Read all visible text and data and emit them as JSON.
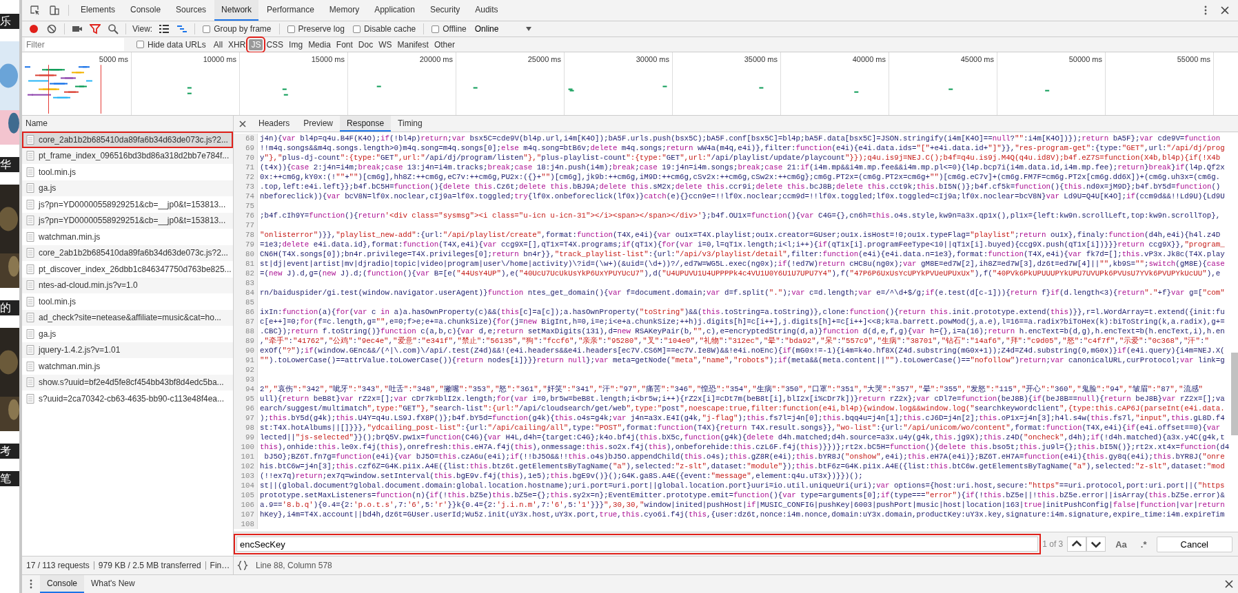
{
  "background_page": {
    "items": [
      {
        "kind": "text",
        "text": "乐"
      },
      {
        "kind": "picture"
      },
      {
        "kind": "text",
        "text": "华"
      },
      {
        "kind": "picture"
      },
      {
        "kind": "text",
        "text": "的"
      },
      {
        "kind": "picture"
      },
      {
        "kind": "text",
        "text": "考"
      },
      {
        "kind": "text",
        "text": "笔"
      }
    ]
  },
  "devtools": {
    "tabs": [
      {
        "label": "Elements",
        "selected": false
      },
      {
        "label": "Console",
        "selected": false
      },
      {
        "label": "Sources",
        "selected": false
      },
      {
        "label": "Network",
        "selected": true
      },
      {
        "label": "Performance",
        "selected": false
      },
      {
        "label": "Memory",
        "selected": false
      },
      {
        "label": "Application",
        "selected": false
      },
      {
        "label": "Security",
        "selected": false
      },
      {
        "label": "Audits",
        "selected": false
      }
    ],
    "toolbar": {
      "recording": true,
      "filter_on": true,
      "view_label": "View:",
      "options": [
        {
          "label": "Group by frame",
          "checked": false
        },
        {
          "label": "Preserve log",
          "checked": false
        },
        {
          "label": "Disable cache",
          "checked": false
        },
        {
          "label": "Offline",
          "checked": false
        }
      ],
      "throttling": "Online"
    },
    "filter_bar": {
      "placeholder": "Filter",
      "hide_data_urls": {
        "label": "Hide data URLs",
        "checked": false
      },
      "types": [
        {
          "label": "All",
          "selected": false
        },
        {
          "label": "XHR",
          "selected": false
        },
        {
          "label": "JS",
          "selected": true
        },
        {
          "label": "CSS",
          "selected": false
        },
        {
          "label": "Img",
          "selected": false
        },
        {
          "label": "Media",
          "selected": false
        },
        {
          "label": "Font",
          "selected": false
        },
        {
          "label": "Doc",
          "selected": false
        },
        {
          "label": "WS",
          "selected": false
        },
        {
          "label": "Manifest",
          "selected": false
        },
        {
          "label": "Other",
          "selected": false
        }
      ]
    },
    "overview": {
      "ticks": [
        "5000 ms",
        "10000 ms",
        "15000 ms",
        "20000 ms",
        "25000 ms",
        "30000 ms",
        "35000 ms",
        "40000 ms",
        "45000 ms",
        "50000 ms",
        "55000 ms"
      ]
    },
    "requests": {
      "column": "Name",
      "rows": [
        {
          "name": "core_2ab1b2b685410da89fa6b34d63de073c.js?2...",
          "selected": true
        },
        {
          "name": "pt_frame_index_096516bd3bd86a318d2bb7e784f...",
          "selected": false
        },
        {
          "name": "tool.min.js",
          "selected": false
        },
        {
          "name": "ga.js",
          "selected": false
        },
        {
          "name": "js?pn=YD00000558929251&cb=__jp0&t=153813...",
          "selected": false
        },
        {
          "name": "js?pn=YD00000558929251&cb=__jp0&t=153813...",
          "selected": false
        },
        {
          "name": "watchman.min.js",
          "selected": false
        },
        {
          "name": "core_2ab1b2b685410da89fa6b34d63de073c.js?2...",
          "selected": false
        },
        {
          "name": "pt_discover_index_26dbb1c846347750d763be825...",
          "selected": false
        },
        {
          "name": "ntes-ad-cloud.min.js?v=1.0",
          "selected": false
        },
        {
          "name": "tool.min.js",
          "selected": false
        },
        {
          "name": "ad_check?site=netease&affiliate=music&cat=ho...",
          "selected": false
        },
        {
          "name": "ga.js",
          "selected": false
        },
        {
          "name": "jquery-1.4.2.js?v=1.01",
          "selected": false
        },
        {
          "name": "watchman.min.js",
          "selected": false
        },
        {
          "name": "show.s?uuid=bf2e4d5fe8cf454bb43bf8d4edc5ba...",
          "selected": false
        },
        {
          "name": "s?uuid=2ca70342-cb63-4635-bb90-c113e48f4ea...",
          "selected": false
        }
      ],
      "summary": [
        "17 / 113 requests",
        "979 KB / 2.5 MB transferred",
        "Fin…"
      ]
    },
    "detail_tabs": [
      {
        "label": "Headers",
        "selected": false
      },
      {
        "label": "Preview",
        "selected": false
      },
      {
        "label": "Response",
        "selected": true
      },
      {
        "label": "Timing",
        "selected": false
      }
    ],
    "response": {
      "lines": [
        {
          "number": "68",
          "text": "j4n){var bl4p=q4u.B4F(K4O);if(!bl4p)return;var bsx5C=cde9V(bl4p.url,i4m[K4O]);bA5F.urls.push(bsx5C);bA5F.conf[bsx5C]=bl4p;bA5F.data[bsx5C]=JSON.stringify(i4m[K4O]==null?\"\":i4m[K4O])});return bA5F};var cde9V=function"
        },
        {
          "number": "69",
          "text": "!!m4q.songs&&m4q.songs.length>0)m4q.song=m4q.songs[0];else m4q.song=btB6v;delete m4q.songs;return wW4a(m4q,e4i)},filter:function(e4i){e4i.data.ids=\"[\"+e4i.data.id+\"]\"}},\"res-program-get\":{type:\"GET\",url:\"/api/dj/prog"
        },
        {
          "number": "70",
          "text": "y\"},\"plus-dj-count\":{type:\"GET\",url:\"/api/dj/program/listen\"},\"plus-playlist-count\":{type:\"GET\",url:\"/api/playlist/update/playcount\"}});q4u.is9j=NEJ.C();b4f=q4u.is9j.M4Q(q4u.id8V);b4f.eZ7S=function(X4b,bl4p){if(!X4b"
        },
        {
          "number": "71",
          "text": "(t4x)){case 2:j4n=i4m;break;case 13:j4n=i4m.tracks;break;case 18:j4n.push(i4m);break;case 19:j4n=i4m.songs;break;case 21:if(i4m.mp&&i4m.mp.fee&&i4m.mp.pl<=0){l4p.bcp7i(i4m.data.id,i4m.mp.fee);return}break}if(l4p.Qf2x"
        },
        {
          "number": "72",
          "text": "0x:++cm6g,kY0x:(!\"\"+\"\")[cm6g],hh8Z:++cm6g,eC7v:++cm6g,PU2x:({}+\"\")[cm6g],jk9b:++cm6g,iM9D:++cm6g,cSv2x:++cm6g,cSw2x:++cm6g};cm6g.PT2x=(cm6g.PT2x=cm6g+\"\")[cm6g.eC7v]+(cm6g.FM7F=cm6g.PT2x[cm6g.dd6X])+(cm6g.uh3x=(cm6g."
        },
        {
          "number": "73",
          "text": ".top,left:e4i.left}};b4f.bC5H=function(){delete this.Cz6t;delete this.bBJ9A;delete this.sM2x;delete this.ccr9i;delete this.bcJ8B;delete this.cct9k;this.bI5N()};b4f.cf5k=function(){this.nd0x=jM9D};b4f.bY5d=function()"
        },
        {
          "number": "74",
          "text": "nbeforeclick)){var bcV8N=lf0x.noclear,cIj9a=lf0x.toggled;try{lf0x.onbeforeclick(lf0x)}catch(e){}ccn9e=!!lf0x.noclear;ccm9d=!!lf0x.toggled;lf0x.toggled=cIj9a;lf0x.noclear=bcV8N}var Ld9U=Q4U[K4O];if(ccm9d&&!!Ld9U){Ld9U"
        },
        {
          "number": "75"
        },
        {
          "number": "76",
          "text": ";b4f.cIh9Y=function(){return'<div class=\"sysmsg\"><i class=\"u-icn u-icn-31\"></i><span></span></div>'};b4f.OU1x=function(){var C4G={},cn6h=this.o4s.style,kw9n=a3x.qp1x(),pl1x={left:kw9n.scrollLeft,top:kw9n.scrollTop},"
        },
        {
          "number": "77"
        },
        {
          "number": "78",
          "text": "\"onlisterror\")}},\"playlist_new-add\":{url:\"/api/playlist/create\",format:function(T4X,e4i){var ou1x=T4X.playlist;ou1x.creator=GUser;ou1x.isHost=!0;ou1x.typeFlag=\"playlist\";return ou1x},finaly:function(d4h,e4i){h4l.z4D"
        },
        {
          "number": "79",
          "text": "=1e3;delete e4i.data.id},format:function(T4X,e4i){var ccg9X=[],qT1x=T4X.programs;if(qT1x){for(var i=0,l=qT1x.length;i<l;i++){if(qT1x[i].programFeeType<10||qT1x[i].buyed){ccg9X.push(qT1x[i])}}}return ccg9X}},\"program_"
        },
        {
          "number": "80",
          "text": "CN6H(T4X.songs[0]);bn4r.privilege=T4X.privileges[0];return bn4r}},\"track_playlist-list\":{url:\"/api/v3/playlist/detail\",filter:function(e4i){e4i.data.n=1e3},format:function(T4X,e4i){var fk7d=[];this.vP3x.Jk8c(T4X.play"
        },
        {
          "number": "81",
          "text": "st|dj|event|artist|mv|djradio|topic|video|program|user\\/home|activity)\\?id=(\\w+)(&uid=(\\d+))?/,ed7W=WG5L.exec(ng0x);if(!ed7W)return cHC8u(ng0x);var gM8E=ed7W[2],ih8Z=ed7W[3],dz6t=ed7W[4]||\"\",kb9S=\"\";switch(gM8E){case"
        },
        {
          "number": "82",
          "text": "=(new J).d,g=(new J).d;(function(){var B=[e(\"44UsY4UP\"),e(\"40UcU7UcUkUsYkP6UxYPUYUcU7\"),d(\"U4UPUVU1U4UPPPPk4c4VU1U0Y6U1U7UPU7Y4\"),f(\"47P6P6UxUsYcUPYkPVUeUPUxUx\"),f(\"40PVk6PkUPUUUPYkUPU7UVUPk6PVUsU7YVk6PVUPYkUcUU\"),e"
        },
        {
          "number": "83"
        },
        {
          "number": "84",
          "text": "rn/baiduspider/gi.test(window.navigator.userAgent)}function ntes_get_domain(){var f=document.domain;var d=f.split(\".\");var c=d.length;var e=/^\\d+$/g;if(e.test(d[c-1])){return f}if(d.length<3){return\".\"+f}var g=[\"com\""
        },
        {
          "number": "85"
        },
        {
          "number": "86",
          "text": "ixIn:function(a){for(var c in a)a.hasOwnProperty(c)&&(this[c]=a[c]);a.hasOwnProperty(\"toString\")&&(this.toString=a.toString)},clone:function(){return this.init.prototype.extend(this)}},r=l.WordArray=t.extend({init:fu"
        },
        {
          "number": "87",
          "text": "c[e++]=0;for(f=c.length,g=\"\",e=0;f>e;e+=a.chunkSize){for(j=new BigInt,h=0,i=e;i<e+a.chunkSize;++h)j.digits[h]=c[i++],j.digits[h]+=c[i++]<<8;k=a.barrett.powMod(j,a.e),l=16==a.radix?biToHex(k):biToString(k,a.radix),g+="
        },
        {
          "number": "88",
          "text": ".CBC});return f.toString()}function c(a,b,c){var d,e;return setMaxDigits(131),d=new RSAKeyPair(b,\"\",c),e=encryptedString(d,a)}function d(d,e,f,g){var h={},i=a(16);return h.encText=b(d,g),h.encText=b(h.encText,i),h.en"
        },
        {
          "number": "89",
          "text": ",\"牵手\":\"41762\",\"公鸡\":\"9ec4e\",\"爱意\":\"e341f\",\"禁止\":\"56135\",\"狗\":\"fccf6\",\"亲亲\":\"95280\",\"叉\":\"104e0\",\"礼物\":\"312ec\",\"晕\":\"bda92\",\"呆\":\"557c9\",\"生病\":\"38701\",\"钻石\":\"14af6\",\"拜\":\"c9d05\",\"怒\":\"c4f7f\",\"示爱\":\"0c368\",\"汗\":\""
        },
        {
          "number": "90",
          "text": "exOf(\"?\");if(window.GEnc&&/(^|\\.com)\\/api/.test(Z4d)&&!(e4i.headers&&e4i.headers[ec7V.CS6M]==ec7V.Ie8W)&&!e4i.noEnc){if(mG0x!=-1){i4m=k4o.hf8X(Z4d.substring(mG0x+1));Z4d=Z4d.substring(0,mG0x)}if(e4i.query){i4m=NEJ.X("
        },
        {
          "number": "91",
          "text": "\"\").toLowerCase()==attrValue.toLowerCase()){return nodes[i]}}}return null};var meta=getNode(\"meta\",\"name\",\"robots\");if(meta&&(meta.content||\"\").toLowerCase()==\"nofollow\")return;var canonicalURL,curProtocol;var link=g"
        },
        {
          "number": "92"
        },
        {
          "number": "93"
        },
        {
          "number": "94",
          "text": "2\",\"哀伤\":\"342\",\"呲牙\":\"343\",\"吐舌\":\"348\",\"撇嘴\":\"353\",\"怒\":\"361\",\"奸笑\":\"341\",\"汗\":\"97\",\"痛苦\":\"346\",\"惶恐\":\"354\",\"生病\":\"350\",\"口罩\":\"351\",\"大哭\":\"357\",\"晕\":\"355\",\"发怒\":\"115\",\"开心\":\"360\",\"鬼脸\":\"94\",\"皱眉\":\"87\",\"流感\""
        },
        {
          "number": "95",
          "text": "ull){return beB8t}var rZ2x=[];var cDr7k=blI2x.length;for(var i=0,br5w=beB8t.length;i<br5w;i++){rZ2x[i]=cDt7m(beB8t[i],blI2x[i%cDr7k])}return rZ2x};var cDl7e=function(beJ8B){if(beJ8B==null){return beJ8B}var rZ2x=[];va"
        },
        {
          "number": "96",
          "text": "earch/suggest/multimatch\",type:\"GET\"},\"search-list\":{url:\"/api/cloudsearch/get/web\",type:\"post\",noescape:true,filter:function(e4i,bl4p){window.log&&window.log(\"searchkeywordclient\",{type:this.cAP6J(parseInt(e4i.data."
        },
        {
          "number": "97",
          "text": ");this.bY5d(g4k);this.U4Y=q4u.LS9J.fX8P()};b4f.bY5d=function(g4k){this.o4s=g4k;var j4n=a3x.E4I(g4k,\"j-flag\");this.fs7l=j4n[0];this.bqq4u=j4n[1];this.cJ6D=j4n[2];this.oP1x=j4n[3];h4l.s4w(this.fs7l,\"input\",this.gL8D.f4"
        },
        {
          "number": "98",
          "text": "st:T4X.hotAlbums||[]}}},\"ydcailing_post-list\":{url:\"/api/cailing/all\",type:\"POST\",format:function(T4X){return T4X.result.songs}},\"wo-list\":{url:\"/api/unicom/wo/content\",format:function(T4X,e4i){if(e4i.offset==0){var"
        },
        {
          "number": "99",
          "text": "lected||\"js-selected\"}}();brQ5V.pw1x=function(C4G){var H4L,d4h={target:C4G};k4o.bf4j(this.bX5c,function(g4k){delete d4h.matched;d4h.source=a3x.u4y(g4k,this.jg9X);this.z4D(\"oncheck\",d4h);if(!d4h.matched){a3x.y4C(g4k,t"
        },
        {
          "number": "100",
          "text": "this),onhide:this.le0x.f4j(this),onrefresh:this.eH7A.f4j(this),onmessage:this.so2x.f4j(this),onbeforehide:this.czL6F.f4j(this)}})};rt2x.bC5H=function(){delete this.bso5t;this.ju9l={};this.bI5N()};rt2x.xt4x=function(d4"
        },
        {
          "number": "101",
          "text": " bJ5O};BZ6T.fn7g=function(e4i){var bJ5O=this.czA6u(e4i);if(!!bJ5O&&!!this.o4s)bJ5O.appendChild(this.o4s);this.gZ8R(e4i);this.bYR8J(\"onshow\",e4i);this.eH7A(e4i)};BZ6T.eH7A=function(e4i){this.gy8q(e4i);this.bYR8J(\"onre"
        },
        {
          "number": "102",
          "text": "his.btC6w=j4n[3];this.czf6Z=G4K.pi1x.A4E({list:this.btz6t.getElementsByTagName(\"a\"),selected:\"z-slt\",dataset:\"module\"});this.btF6z=G4K.pi1x.A4E({list:this.btC6w.getElementsByTagName(\"a\"),selected:\"z-slt\",dataset:\"mod"
        },
        {
          "number": "103",
          "text": "(!!ex7q)return;ex7q=window.setInterval(this.bgE9v.f4j(this),1e5);this.bgE9v()}();G4K.ga8S.A4E({event:\"message\",element:q4u.uT3x})}})();"
        },
        {
          "number": "104",
          "text": "st||(global.document?global.document.domain:global.location.hostname);uri.port=uri.port||global.location.port}uuri=io.util.uniqueUri(uri);var options={host:uri.host,secure:\"https\"==uri.protocol,port:uri.port||(\"https"
        },
        {
          "number": "105",
          "text": "prototype.setMaxListeners=function(n){if(!this.bZ5e)this.bZ5e={};this.sy2x=n};EventEmitter.prototype.emit=function(){var type=arguments[0];if(type===\"error\"){if(!this.bZ5e||!this.bZ5e.error||isArray(this.bZ5e.error)&"
        },
        {
          "number": "106",
          "text": "a.9=='8.b.q'){0.4={2:'p.o.t.s',7:'6',5:'r'}}k{0.4={2:'j.i.n.m',7:'6',5:'1'}}}\",30,30,\"window|inited|pushHost|if|MUSIC_CONFIG|pushKey|6003|pushPort|music|host|location|163|true|initPushConfig|false|function|var|return"
        },
        {
          "number": "107",
          "text": "hKey},i4m=T4X.account||bd4h,dz6t=GUser.userId;Wu5z.init(uY3x.host,uY3x.port,true,this.cyo6i.f4j(this,{user:dz6t,nonce:i4m.nonce,domain:uY3x.domain,productKey:uY3x.key,signature:i4m.signature,expire_time:i4m.expireTim"
        },
        {
          "number": "108"
        }
      ]
    },
    "search": {
      "value": "encSecKey",
      "count": "1 of 3",
      "case_label": "Aa",
      "regex_label": ".*",
      "cancel": "Cancel"
    },
    "status": {
      "position": "Line 88, Column 578"
    },
    "drawer": {
      "tabs": [
        {
          "label": "Console",
          "selected": true
        },
        {
          "label": "What's New",
          "selected": false
        }
      ]
    }
  }
}
